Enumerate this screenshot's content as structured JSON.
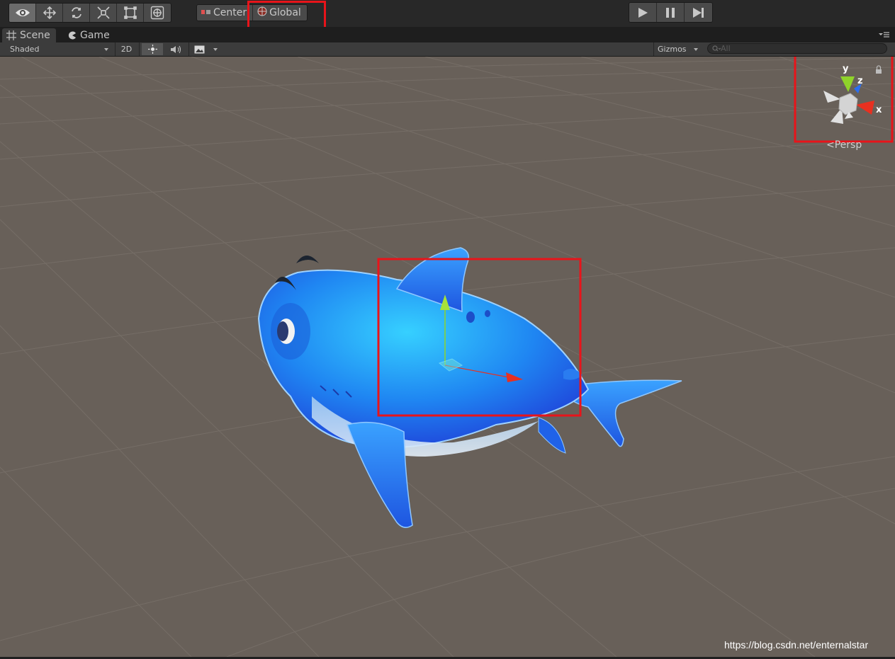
{
  "toolbar": {
    "tools": [
      {
        "name": "view-tool",
        "icon": "eye-icon",
        "active": true
      },
      {
        "name": "move-tool",
        "icon": "move-arrows-icon",
        "active": false
      },
      {
        "name": "rotate-tool",
        "icon": "rotate-icon",
        "active": false
      },
      {
        "name": "scale-tool",
        "icon": "scale-icon",
        "active": false
      },
      {
        "name": "rect-tool",
        "icon": "rect-icon",
        "active": false
      },
      {
        "name": "transform-tool",
        "icon": "transform-icon",
        "active": false
      }
    ],
    "pivot_mode": "Center",
    "pivot_rotation": "Global",
    "playback": {
      "play_icon": "play-icon",
      "pause_icon": "pause-icon",
      "step_icon": "step-icon"
    }
  },
  "tabs": [
    {
      "label": "Scene",
      "icon": "grid-icon",
      "active": true
    },
    {
      "label": "Game",
      "icon": "pacman-icon",
      "active": false
    }
  ],
  "scene_toolbar": {
    "draw_mode": "Shaded",
    "mode_2d": "2D",
    "lighting_icon": "sun-icon",
    "audio_icon": "speaker-icon",
    "effects_icon": "image-icon",
    "gizmos": "Gizmos",
    "search_placeholder": "All"
  },
  "scene_gizmo": {
    "axis_y": "y",
    "axis_z": "z",
    "axis_x": "x",
    "projection": "Persp",
    "lock_icon": "lock-icon"
  },
  "watermark": "https://blog.csdn.net/enternalstar",
  "colors": {
    "highlight": "#e8141a",
    "viewport_bg": "#686059",
    "shark_blue": "#1f7ff0",
    "axis_x": "#e83020",
    "axis_y": "#8fd32a",
    "axis_z": "#2a6ef0"
  }
}
